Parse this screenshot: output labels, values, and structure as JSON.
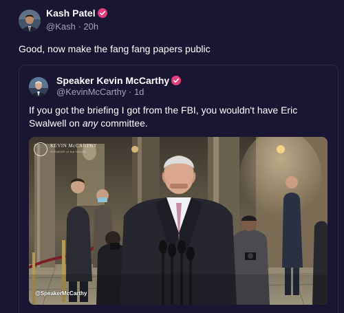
{
  "post": {
    "author_name": "Kash Patel",
    "author_handle": "@Kash",
    "separator": "·",
    "time": "20h",
    "text": "Good, now make the fang fang papers public",
    "avatar_icon": "user-avatar"
  },
  "quote": {
    "author_name": "Speaker Kevin McCarthy",
    "author_handle": "@KevinMcCarthy",
    "separator": "·",
    "time": "1d",
    "text_before": "If you got the briefing I got from the FBI, you wouldn't have Eric Swalwell on ",
    "text_emphasis": "any",
    "text_after": " committee.",
    "avatar_icon": "user-avatar",
    "media": {
      "watermark_title": "KEVIN McCARTHY",
      "watermark_subtitle": "SPEAKER of the HOUSE",
      "credit": "@SpeakerMcCarthy"
    }
  },
  "colors": {
    "background": "#1a1531",
    "verified_badge": "#e23d7d",
    "muted_text": "#a7a1bd"
  }
}
